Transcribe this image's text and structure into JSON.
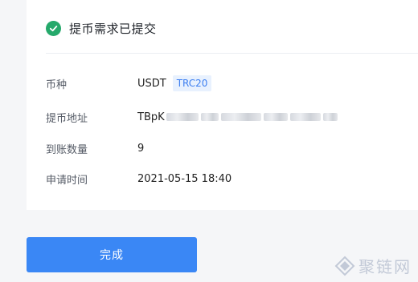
{
  "status": {
    "title": "提币需求已提交"
  },
  "details": {
    "currency": {
      "label": "币种",
      "value": "USDT",
      "network": "TRC20"
    },
    "address": {
      "label": "提币地址",
      "value_prefix": "TBpK"
    },
    "amount": {
      "label": "到账数量",
      "value": "9"
    },
    "time": {
      "label": "申请时间",
      "value": "2021-05-15 18:40"
    }
  },
  "actions": {
    "done_label": "完成"
  },
  "watermark": {
    "text": "聚链网"
  },
  "colors": {
    "success": "#25a96b",
    "primary": "#3a87f5",
    "tag_bg": "#e8f1fe",
    "tag_text": "#3d7ff0"
  }
}
